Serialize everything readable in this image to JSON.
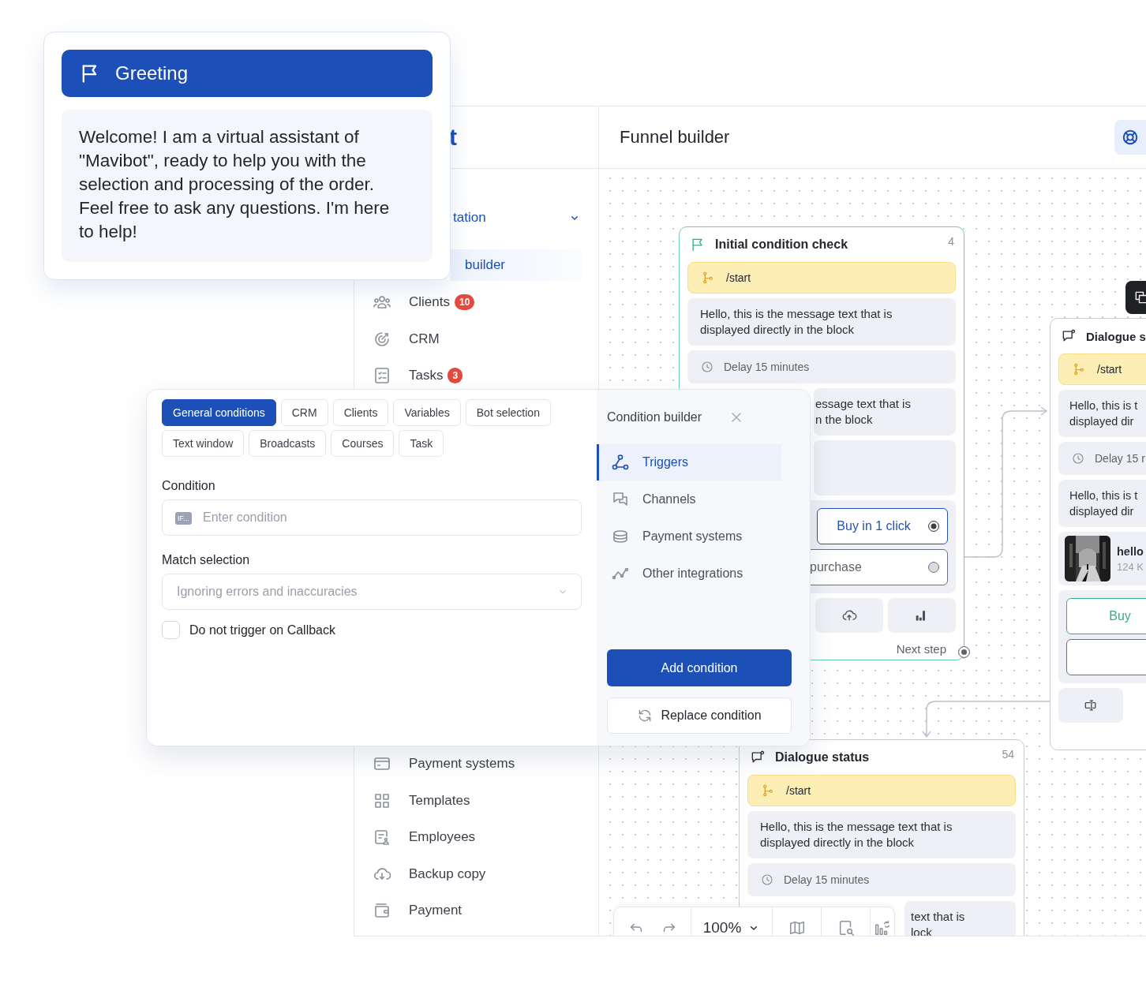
{
  "greeting": {
    "title": "Greeting",
    "message": "Welcome! I am a virtual assistant of \"Mavibot\", ready to help you with the selection and processing of the order. Feel free to ask any questions. I'm here to help!"
  },
  "sidebar": {
    "logo": "t",
    "items": [
      {
        "label": "tation",
        "kind": "group",
        "selected": false
      },
      {
        "label": "builder",
        "kind": "sub",
        "selected": true
      },
      {
        "label": "Clients",
        "kind": "item",
        "selected": false,
        "badge": "10"
      },
      {
        "label": "CRM",
        "kind": "item",
        "selected": false
      },
      {
        "label": "Tasks",
        "kind": "item",
        "selected": false,
        "badge": "3"
      },
      {
        "label": "Payment systems",
        "kind": "item",
        "selected": false
      },
      {
        "label": "Templates",
        "kind": "item",
        "selected": false
      },
      {
        "label": "Employees",
        "kind": "item",
        "selected": false
      },
      {
        "label": "Backup copy",
        "kind": "item",
        "selected": false
      },
      {
        "label": "Payment",
        "kind": "item",
        "selected": false
      }
    ]
  },
  "header": {
    "title": "Funnel builder"
  },
  "nodes": [
    {
      "title": "Initial condition check",
      "count": "4",
      "next": "Next step",
      "blocks": [
        {
          "kind": "trigger",
          "text": "/start"
        },
        {
          "kind": "message",
          "text": "Hello, this is the message text that is\ndisplayed directly in the block"
        },
        {
          "kind": "delay",
          "text": "Delay 15 minutes"
        },
        {
          "kind": "message",
          "text": "essage text that is\nn the block"
        },
        {
          "kind": "empty"
        },
        {
          "kind": "buttons",
          "buttons": [
            {
              "label": "Buy in 1 click",
              "color": "#2552b8",
              "selected": true
            },
            {
              "label": "purchase",
              "color": "#6b7180",
              "selected": false
            }
          ]
        },
        {
          "kind": "tools"
        }
      ]
    },
    {
      "title": "Dialogue s",
      "blocks": [
        {
          "kind": "trigger",
          "text": "/start"
        },
        {
          "kind": "message",
          "text": "Hello, this is t\ndisplayed dir"
        },
        {
          "kind": "delay",
          "text": "Delay 15 r"
        },
        {
          "kind": "message",
          "text": "Hello, this is t\ndisplayed dir"
        },
        {
          "kind": "file",
          "name": "hello",
          "size": "124 K"
        },
        {
          "kind": "buttons",
          "buttons": [
            {
              "label": "Buy",
              "color": "#2fb37e"
            },
            {
              "color": "#6b7180"
            }
          ]
        },
        {
          "kind": "tools"
        }
      ]
    },
    {
      "title": "Dialogue status",
      "count": "54",
      "blocks": [
        {
          "kind": "trigger",
          "text": "/start"
        },
        {
          "kind": "message",
          "text": "Hello, this is the message text that is\ndisplayed directly in the block"
        },
        {
          "kind": "delay",
          "text": "Delay 15 minutes"
        },
        {
          "kind": "message",
          "text": "text that is\nlock"
        }
      ]
    }
  ],
  "toolbar": {
    "zoom": "100%"
  },
  "modal": {
    "tabs": [
      {
        "label": "General conditions",
        "selected": true
      },
      {
        "label": "CRM",
        "selected": false
      },
      {
        "label": "Clients",
        "selected": false
      },
      {
        "label": "Variables",
        "selected": false
      },
      {
        "label": "Bot selection",
        "selected": false
      },
      {
        "label": "Text window",
        "selected": false
      },
      {
        "label": "Broadcasts",
        "selected": false
      },
      {
        "label": "Courses",
        "selected": false
      },
      {
        "label": "Task",
        "selected": false
      }
    ],
    "condition": {
      "label": "Condition",
      "prefix": "IF...",
      "placeholder": "Enter condition"
    },
    "match": {
      "label": "Match selection",
      "placeholder": "Ignoring errors and inaccuracies"
    },
    "callback": {
      "label": "Do not trigger on Callback",
      "checked": false
    },
    "builder": {
      "title": "Condition builder",
      "items": [
        {
          "label": "Triggers",
          "selected": true
        },
        {
          "label": "Channels",
          "selected": false
        },
        {
          "label": "Payment systems",
          "selected": false
        },
        {
          "label": "Other integrations",
          "selected": false
        }
      ],
      "primary": "Add condition",
      "secondary": "Replace condition"
    }
  }
}
